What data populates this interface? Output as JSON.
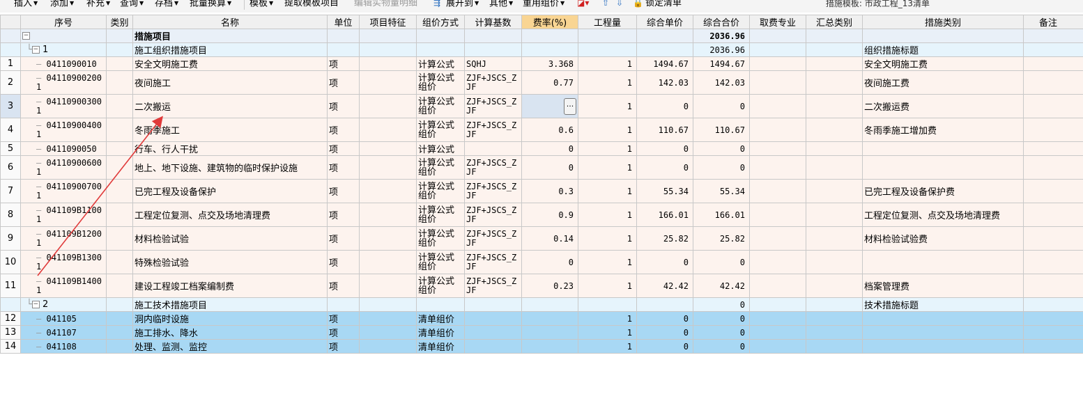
{
  "toolbar": {
    "items": [
      "插入",
      "添加",
      "补充",
      "查询",
      "存档",
      "批量换算",
      "模板",
      "提取模板项目",
      "编辑实物量明细",
      "展开到",
      "其他",
      "重用组价",
      "锁定清单"
    ],
    "template_info": "措施模板: 市政工程_13清单"
  },
  "columns": [
    "序号",
    "类别",
    "名称",
    "单位",
    "项目特征",
    "组价方式",
    "计算基数",
    "费率(%)",
    "工程量",
    "综合单价",
    "综合合价",
    "取费专业",
    "汇总类别",
    "措施类别",
    "备注"
  ],
  "rows": [
    {
      "num": "",
      "code": "",
      "name": "措施项目",
      "unit": "",
      "method": "",
      "base": "",
      "rate": "",
      "qty": "",
      "price": "",
      "total": "2036.96",
      "category": ""
    },
    {
      "num": "",
      "code": "1",
      "name": "施工组织措施项目",
      "unit": "",
      "method": "",
      "base": "",
      "rate": "",
      "qty": "",
      "price": "",
      "total": "2036.96",
      "category": "组织措施标题"
    },
    {
      "num": "1",
      "code": "0411090010",
      "name": "安全文明施工费",
      "unit": "项",
      "method": "计算公式",
      "base": "SQHJ",
      "rate": "3.368",
      "qty": "1",
      "price": "1494.67",
      "total": "1494.67",
      "category": "安全文明施工费"
    },
    {
      "num": "2",
      "code": "041109002001",
      "name": "夜间施工",
      "unit": "项",
      "method": "计算公式组价",
      "base": "ZJF+JSCS_ZJF",
      "rate": "0.77",
      "qty": "1",
      "price": "142.03",
      "total": "142.03",
      "category": "夜间施工费"
    },
    {
      "num": "3",
      "code": "041109003001",
      "name": "二次搬运",
      "unit": "项",
      "method": "计算公式组价",
      "base": "ZJF+JSCS_ZJF",
      "rate": "",
      "qty": "1",
      "price": "0",
      "total": "0",
      "category": "二次搬运费"
    },
    {
      "num": "4",
      "code": "041109004001",
      "name": "冬雨季施工",
      "unit": "项",
      "method": "计算公式组价",
      "base": "ZJF+JSCS_ZJF",
      "rate": "0.6",
      "qty": "1",
      "price": "110.67",
      "total": "110.67",
      "category": "冬雨季施工增加费"
    },
    {
      "num": "5",
      "code": "0411090050",
      "name": "行车、行人干扰",
      "unit": "项",
      "method": "计算公式",
      "base": "",
      "rate": "0",
      "qty": "1",
      "price": "0",
      "total": "0",
      "category": ""
    },
    {
      "num": "6",
      "code": "041109006001",
      "name": "地上、地下设施、建筑物的临时保护设施",
      "unit": "项",
      "method": "计算公式组价",
      "base": "ZJF+JSCS_ZJF",
      "rate": "0",
      "qty": "1",
      "price": "0",
      "total": "0",
      "category": ""
    },
    {
      "num": "7",
      "code": "041109007001",
      "name": "已完工程及设备保护",
      "unit": "项",
      "method": "计算公式组价",
      "base": "ZJF+JSCS_ZJF",
      "rate": "0.3",
      "qty": "1",
      "price": "55.34",
      "total": "55.34",
      "category": "已完工程及设备保护费"
    },
    {
      "num": "8",
      "code": "041109B11001",
      "name": "工程定位复测、点交及场地清理费",
      "unit": "项",
      "method": "计算公式组价",
      "base": "ZJF+JSCS_ZJF",
      "rate": "0.9",
      "qty": "1",
      "price": "166.01",
      "total": "166.01",
      "category": "工程定位复测、点交及场地清理费"
    },
    {
      "num": "9",
      "code": "041109B12001",
      "name": "材料检验试验",
      "unit": "项",
      "method": "计算公式组价",
      "base": "ZJF+JSCS_ZJF",
      "rate": "0.14",
      "qty": "1",
      "price": "25.82",
      "total": "25.82",
      "category": "材料检验试验费"
    },
    {
      "num": "10",
      "code": "041109B13001",
      "name": "特殊检验试验",
      "unit": "项",
      "method": "计算公式组价",
      "base": "ZJF+JSCS_ZJF",
      "rate": "0",
      "qty": "1",
      "price": "0",
      "total": "0",
      "category": ""
    },
    {
      "num": "11",
      "code": "041109B14001",
      "name": "建设工程竣工档案编制费",
      "unit": "项",
      "method": "计算公式组价",
      "base": "ZJF+JSCS_ZJF",
      "rate": "0.23",
      "qty": "1",
      "price": "42.42",
      "total": "42.42",
      "category": "档案管理费"
    },
    {
      "num": "",
      "code": "2",
      "name": "施工技术措施项目",
      "unit": "",
      "method": "",
      "base": "",
      "rate": "",
      "qty": "",
      "price": "",
      "total": "0",
      "category": "技术措施标题"
    },
    {
      "num": "12",
      "code": "041105",
      "name": "洞内临时设施",
      "unit": "项",
      "method": "清单组价",
      "base": "",
      "rate": "",
      "qty": "1",
      "price": "0",
      "total": "0",
      "category": ""
    },
    {
      "num": "13",
      "code": "041107",
      "name": "施工排水、降水",
      "unit": "项",
      "method": "清单组价",
      "base": "",
      "rate": "",
      "qty": "1",
      "price": "0",
      "total": "0",
      "category": ""
    },
    {
      "num": "14",
      "code": "041108",
      "name": "处理、监测、监控",
      "unit": "项",
      "method": "清单组价",
      "base": "",
      "rate": "",
      "qty": "1",
      "price": "0",
      "total": "0",
      "category": ""
    }
  ],
  "colors": {
    "header_bg": "#f0f0f0",
    "rate_header_bg": "#f9d593",
    "item_bg": "#fdf3ee",
    "tech_item_bg": "#a8d8f4",
    "arrow": "#e03a3a"
  },
  "icons": [
    "dropdown-arrow-icon",
    "palette-icon",
    "move-up-icon",
    "move-down-icon",
    "lock-icon",
    "collapse-icon",
    "ellipsis-icon"
  ]
}
